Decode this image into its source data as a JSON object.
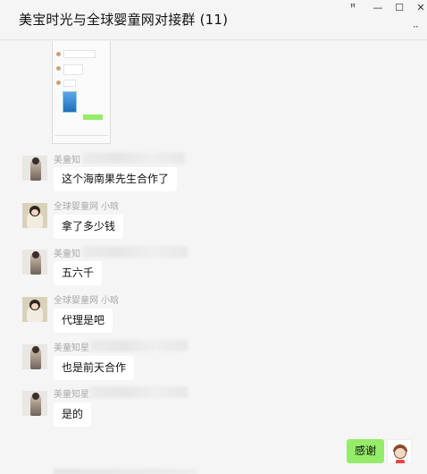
{
  "window": {
    "title": "美宝时光与全球婴童网对接群 (11)",
    "controls": {
      "pin": "ꟸ",
      "minimize": "—",
      "maximize": "☐",
      "close": "✕",
      "more": "··"
    }
  },
  "messages": [
    {
      "sender": "美童知",
      "text": "这个海南果先生合作了"
    },
    {
      "sender": "全球婴童网   小晗",
      "text": "拿了多少钱"
    },
    {
      "sender": "美童知",
      "text": "五六千"
    },
    {
      "sender": "全球婴童网   小晗",
      "text": "代理是吧"
    },
    {
      "sender": "美童知星",
      "text": "也是前天合作"
    },
    {
      "sender": "美童知星",
      "text": "是的"
    }
  ],
  "my_message": {
    "text": "感谢"
  },
  "colors": {
    "my_bubble": "#95ec69",
    "other_bubble": "#ffffff",
    "background": "#f5f5f5"
  }
}
